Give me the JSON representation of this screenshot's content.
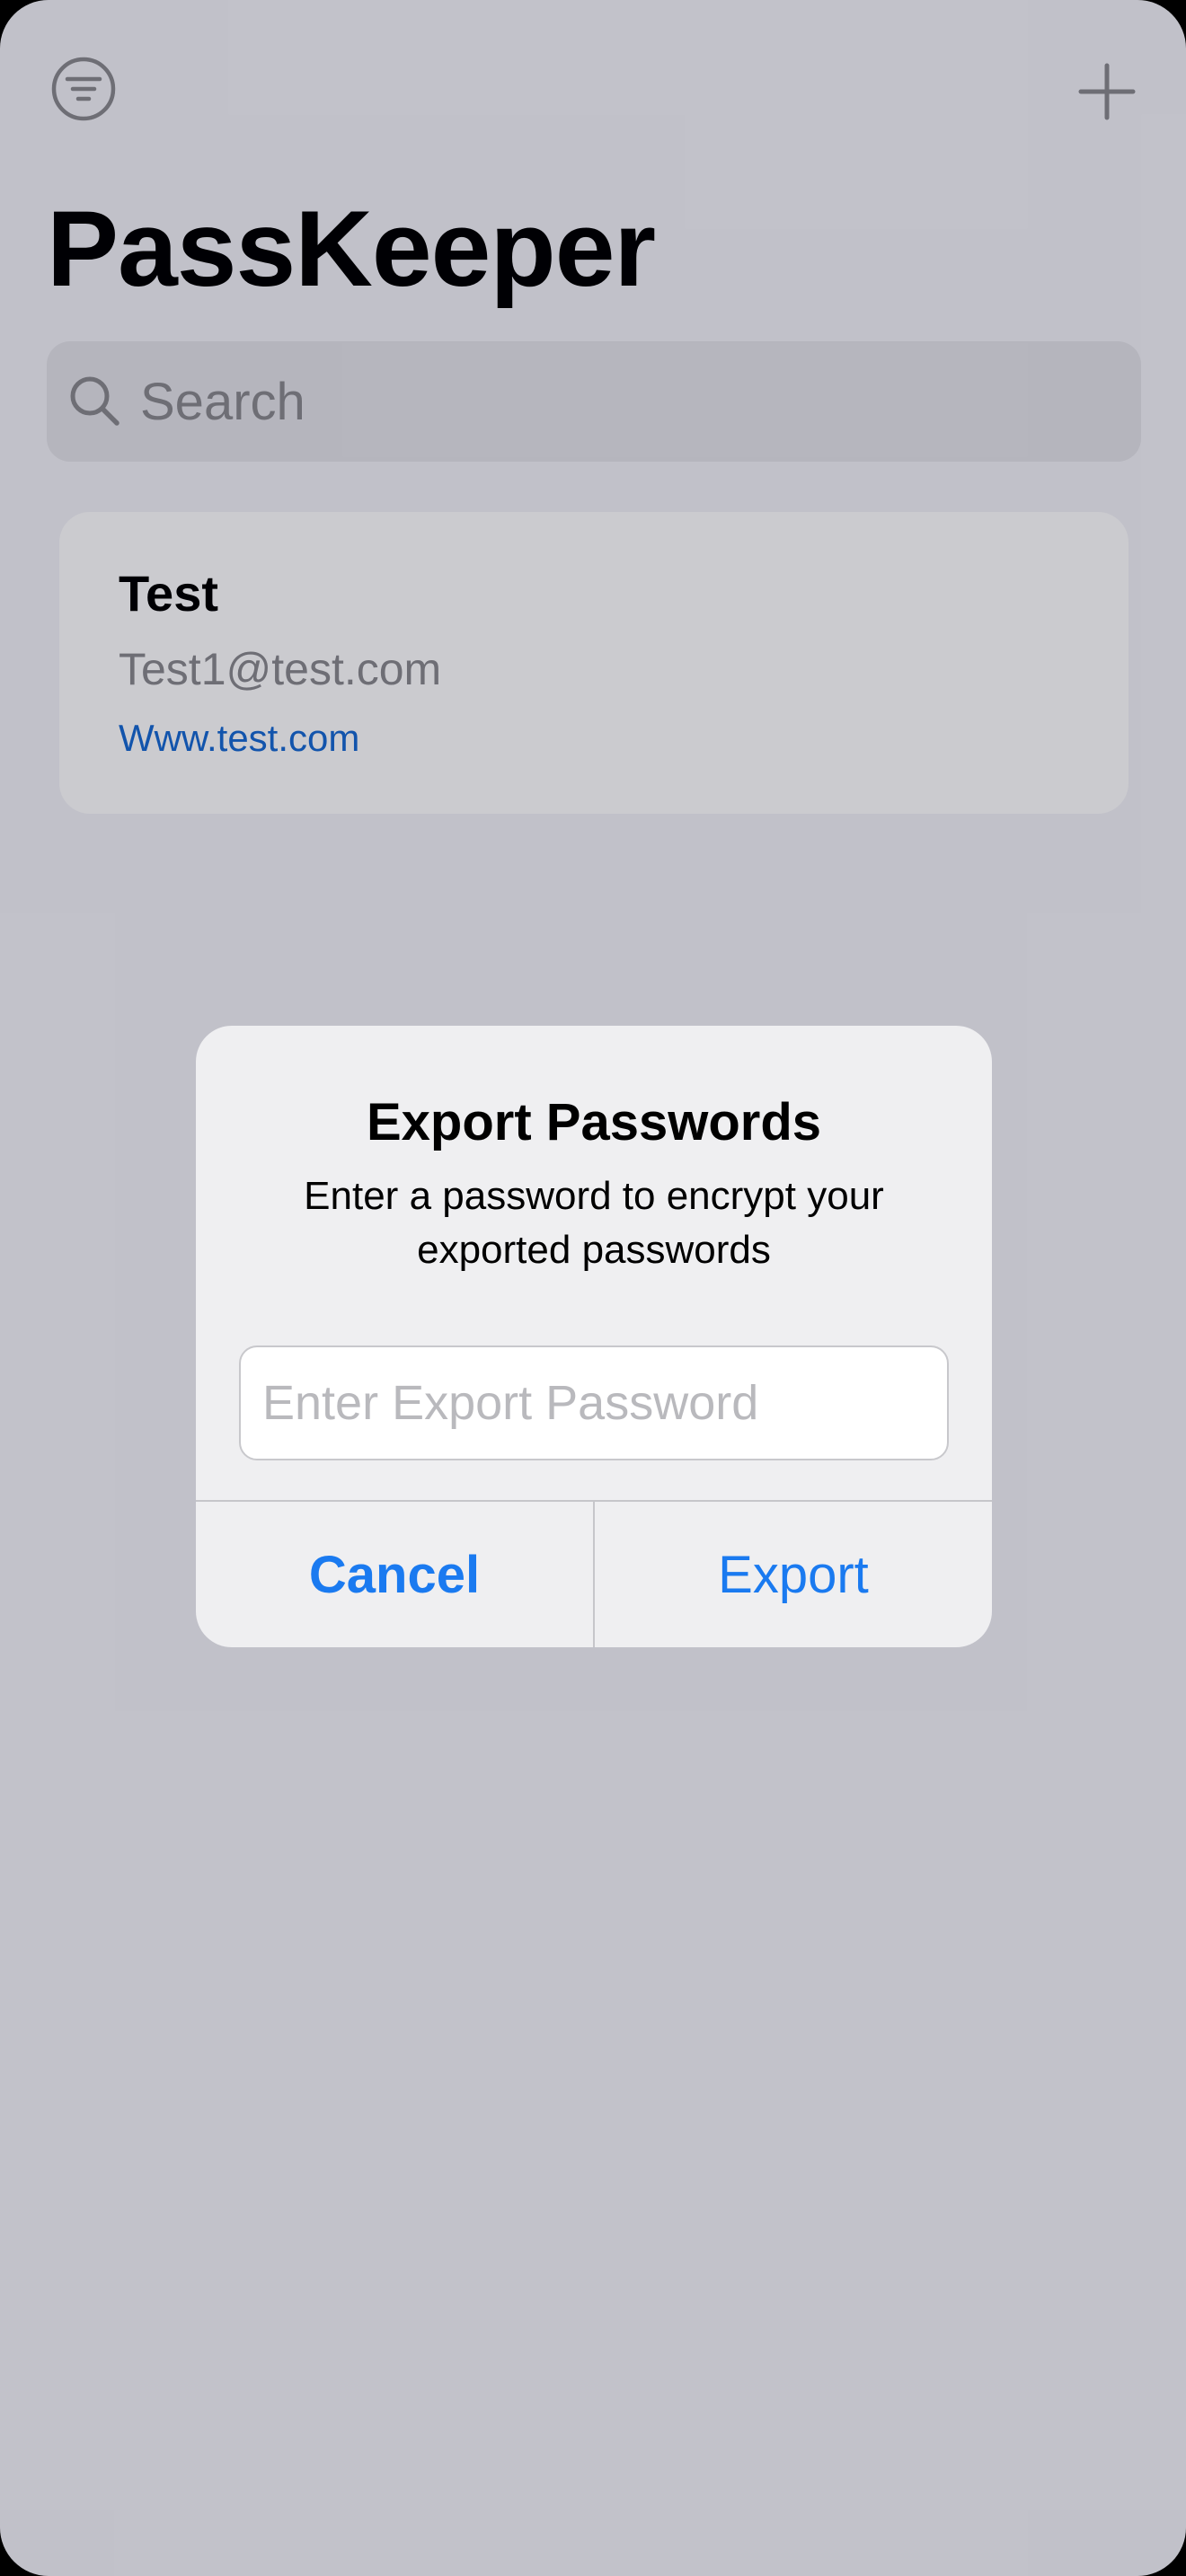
{
  "app": {
    "title": "PassKeeper"
  },
  "toolbar": {
    "filter_icon": "filter-icon",
    "add_icon": "plus-icon"
  },
  "search": {
    "placeholder": "Search",
    "icon": "search-icon"
  },
  "entries": [
    {
      "title": "Test",
      "email": "Test1@test.com",
      "url": "Www.test.com"
    }
  ],
  "alert": {
    "title": "Export Passwords",
    "message": "Enter a password to encrypt your exported passwords",
    "input_placeholder": "Enter Export Password",
    "input_value": "",
    "cancel_label": "Cancel",
    "export_label": "Export"
  },
  "colors": {
    "accent": "#1a7af0",
    "link": "#1769d2",
    "background": "#f2f2f7",
    "card": "#fefefe",
    "secondary_text": "#8a8a8e"
  }
}
